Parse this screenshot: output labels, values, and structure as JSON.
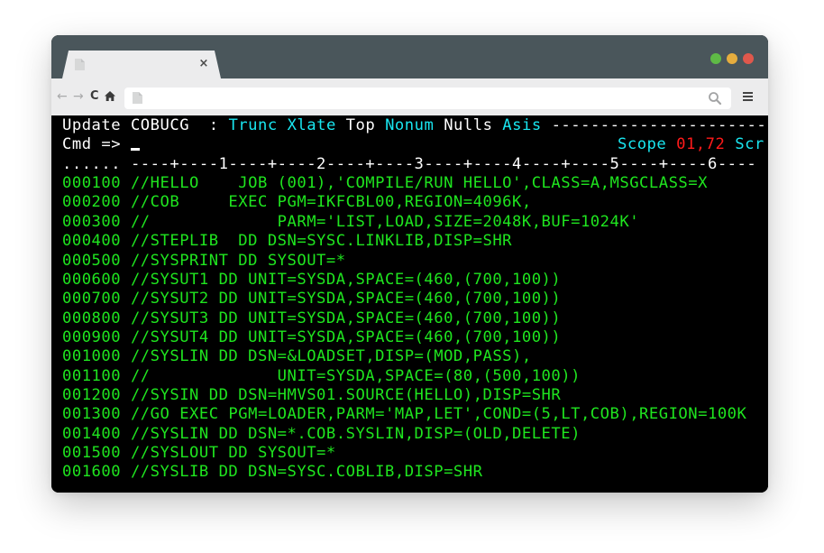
{
  "browser": {
    "tab": {
      "title": "",
      "close_glyph": "×"
    },
    "window_controls": {
      "colors": {
        "minimize": "#5fba46",
        "maximize": "#e6ad3e",
        "close": "#e0584c"
      }
    },
    "nav": {
      "back_glyph": "←",
      "forward_glyph": "→",
      "reload_glyph": "C",
      "home_glyph": "⌂"
    },
    "address_bar": {
      "value": "",
      "placeholder": ""
    }
  },
  "terminal": {
    "colors": {
      "white": "#ffffff",
      "cyan": "#19e6f0",
      "red": "#ff1a1a",
      "green": "#1fe51f",
      "background": "#000000"
    },
    "header": {
      "mode": "Update",
      "member": "COBUCG",
      "sep": "  :",
      "opt_trunc": "Trunc",
      "opt_xlate": "Xlate",
      "opt_top": "Top",
      "opt_nonum": "Nonum",
      "opt_nulls": "Nulls",
      "opt_asis": "Asis",
      "dashes": "----------------------"
    },
    "command": {
      "prompt": "Cmd =>",
      "value": "",
      "scope_label": "Scope",
      "scope_value": "01,72",
      "scroll_label": "Scr"
    },
    "ruler": {
      "prefix": "......",
      "scale": "----+----1----+----2----+----3----+----4----+----5----+----6----"
    },
    "lines": [
      {
        "num": "000100",
        "text": "//HELLO    JOB (001),'COMPILE/RUN HELLO',CLASS=A,MSGCLASS=X"
      },
      {
        "num": "000200",
        "text": "//COB     EXEC PGM=IKFCBL00,REGION=4096K,"
      },
      {
        "num": "000300",
        "text": "//             PARM='LIST,LOAD,SIZE=2048K,BUF=1024K'"
      },
      {
        "num": "000400",
        "text": "//STEPLIB  DD DSN=SYSC.LINKLIB,DISP=SHR"
      },
      {
        "num": "000500",
        "text": "//SYSPRINT DD SYSOUT=*"
      },
      {
        "num": "000600",
        "text": "//SYSUT1 DD UNIT=SYSDA,SPACE=(460,(700,100))"
      },
      {
        "num": "000700",
        "text": "//SYSUT2 DD UNIT=SYSDA,SPACE=(460,(700,100))"
      },
      {
        "num": "000800",
        "text": "//SYSUT3 DD UNIT=SYSDA,SPACE=(460,(700,100))"
      },
      {
        "num": "000900",
        "text": "//SYSUT4 DD UNIT=SYSDA,SPACE=(460,(700,100))"
      },
      {
        "num": "001000",
        "text": "//SYSLIN DD DSN=&LOADSET,DISP=(MOD,PASS),"
      },
      {
        "num": "001100",
        "text": "//             UNIT=SYSDA,SPACE=(80,(500,100))"
      },
      {
        "num": "001200",
        "text": "//SYSIN DD DSN=HMVS01.SOURCE(HELLO),DISP=SHR"
      },
      {
        "num": "001300",
        "text": "//GO EXEC PGM=LOADER,PARM='MAP,LET',COND=(5,LT,COB),REGION=100K"
      },
      {
        "num": "001400",
        "text": "//SYSLIN DD DSN=*.COB.SYSLIN,DISP=(OLD,DELETE)"
      },
      {
        "num": "001500",
        "text": "//SYSLOUT DD SYSOUT=*"
      },
      {
        "num": "001600",
        "text": "//SYSLIB DD DSN=SYSC.COBLIB,DISP=SHR"
      }
    ]
  }
}
